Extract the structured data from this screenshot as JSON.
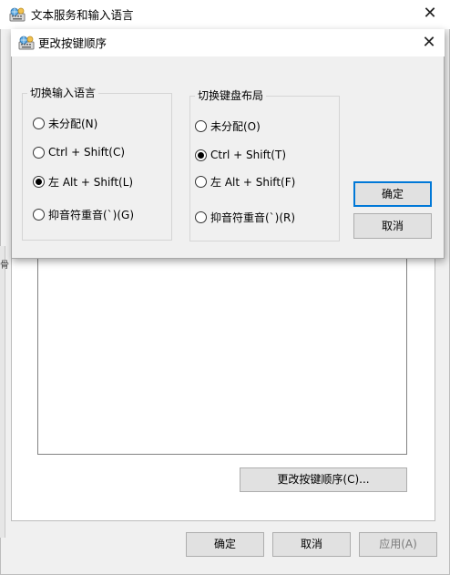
{
  "outer": {
    "title": "文本服务和输入语言",
    "close_glyph": "✕",
    "change_sequence_button": "更改按键顺序(C)...",
    "ok_button": "确定",
    "cancel_button": "取消",
    "apply_button": "应用(A)",
    "left_strip_glyph": "骨"
  },
  "dialog": {
    "title": "更改按键顺序",
    "close_glyph": "✕",
    "input_language": {
      "title": "切换输入语言",
      "options": [
        {
          "label": "未分配(N)",
          "checked": false
        },
        {
          "label": "Ctrl + Shift(C)",
          "checked": false
        },
        {
          "label": "左 Alt + Shift(L)",
          "checked": true
        },
        {
          "label": "抑音符重音(`)(G)",
          "checked": false
        }
      ]
    },
    "keyboard_layout": {
      "title": "切换键盘布局",
      "options": [
        {
          "label": "未分配(O)",
          "checked": false
        },
        {
          "label": "Ctrl + Shift(T)",
          "checked": true
        },
        {
          "label": "左 Alt + Shift(F)",
          "checked": false
        },
        {
          "label": "抑音符重音(`)(R)",
          "checked": false
        }
      ]
    },
    "ok_button": "确定",
    "cancel_button": "取消"
  },
  "icons": {
    "app": "keyboard-globe-icon",
    "close": "close-icon"
  }
}
